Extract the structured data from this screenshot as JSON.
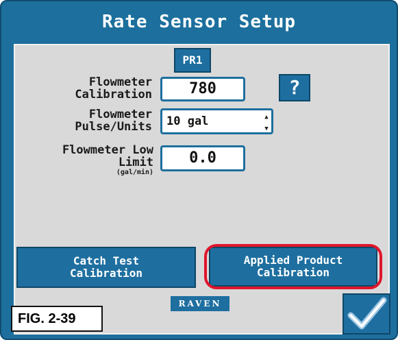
{
  "title": "Rate Sensor Setup",
  "tab": {
    "label": "PR1"
  },
  "fields": {
    "calibration": {
      "label_line1": "Flowmeter",
      "label_line2": "Calibration",
      "value": "780"
    },
    "pulse_units": {
      "label_line1": "Flowmeter",
      "label_line2": "Pulse/Units",
      "value": "10 gal"
    },
    "low_limit": {
      "label_line1": "Flowmeter Low",
      "label_line2": "Limit",
      "label_unit": "(gal/min)",
      "value": "0.0"
    }
  },
  "help_button": {
    "label": "?"
  },
  "buttons": {
    "catch_test": {
      "line1": "Catch Test",
      "line2": "Calibration"
    },
    "applied_product": {
      "line1": "Applied Product",
      "line2": "Calibration"
    }
  },
  "logo": {
    "text": "RAVEN"
  },
  "figure_label": "FIG. 2-39",
  "icons": {
    "help": "question-icon",
    "accept": "checkmark-icon",
    "spinner": "spinner-arrows-icon"
  },
  "colors": {
    "accent": "#1e6fa0",
    "panel": "#d9d9d9",
    "highlight": "#e0162b"
  }
}
